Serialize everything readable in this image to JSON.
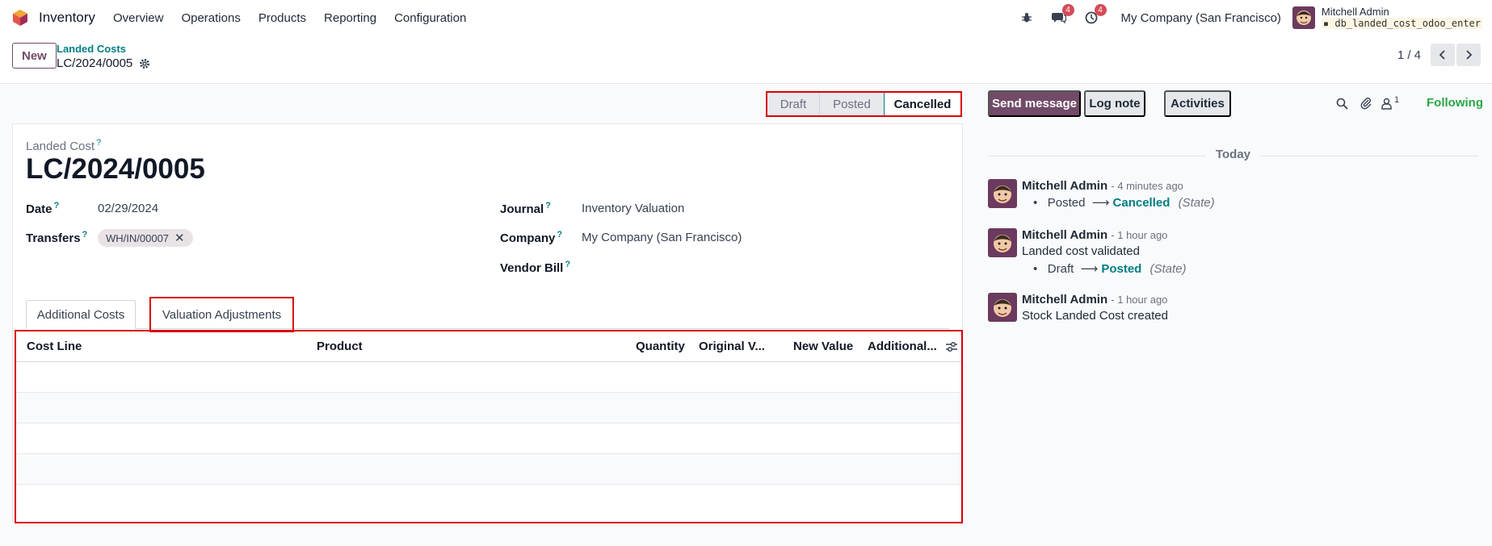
{
  "app": {
    "name": "Inventory"
  },
  "nav": [
    "Overview",
    "Operations",
    "Products",
    "Reporting",
    "Configuration"
  ],
  "systray": {
    "messages_count": "4",
    "activities_count": "4",
    "company": "My Company (San Francisco)",
    "user": "Mitchell Admin",
    "db": "db_landed_cost_odoo_enter"
  },
  "control": {
    "new_label": "New",
    "breadcrumb": "Landed Costs",
    "record": "LC/2024/0005",
    "pager": "1 / 4"
  },
  "statusbar": {
    "stages": [
      "Draft",
      "Posted",
      "Cancelled"
    ],
    "active": "Cancelled"
  },
  "form": {
    "label": "Landed Cost",
    "title": "LC/2024/0005",
    "help": "?",
    "date_label": "Date",
    "date_value": "02/29/2024",
    "transfers_label": "Transfers",
    "transfer_tag": "WH/IN/00007",
    "journal_label": "Journal",
    "journal_value": "Inventory Valuation",
    "company_label": "Company",
    "company_value": "My Company (San Francisco)",
    "vendor_bill_label": "Vendor Bill"
  },
  "tabs": [
    "Additional Costs",
    "Valuation Adjustments"
  ],
  "table": {
    "columns": [
      "Cost Line",
      "Product",
      "Quantity",
      "Original V...",
      "New Value",
      "Additional..."
    ]
  },
  "chatter": {
    "send_message": "Send message",
    "log_note": "Log note",
    "activities": "Activities",
    "followers_count": "1",
    "following": "Following",
    "day": "Today",
    "messages": [
      {
        "author": "Mitchell Admin",
        "time": "- 4 minutes ago",
        "body": "",
        "tracking": {
          "old": "Posted",
          "arrow": "⟶",
          "new": "Cancelled",
          "field": "(State)"
        }
      },
      {
        "author": "Mitchell Admin",
        "time": "- 1 hour ago",
        "body": "Landed cost validated",
        "tracking": {
          "old": "Draft",
          "arrow": "⟶",
          "new": "Posted",
          "field": "(State)"
        }
      },
      {
        "author": "Mitchell Admin",
        "time": "- 1 hour ago",
        "body": "Stock Landed Cost created"
      }
    ]
  },
  "colors": {
    "brand": "#714b67",
    "accent": "#017e84",
    "highlight": "#d8000c",
    "following": "#28a745"
  }
}
